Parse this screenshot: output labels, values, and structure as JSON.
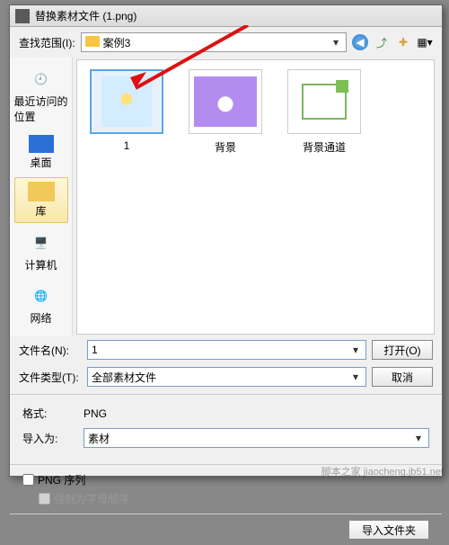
{
  "title": "替换素材文件 (1.png)",
  "lookin": {
    "label": "查找范围(I):",
    "folder": "案例3"
  },
  "places": [
    {
      "label": "最近访问的位置"
    },
    {
      "label": "桌面"
    },
    {
      "label": "库"
    },
    {
      "label": "计算机"
    },
    {
      "label": "网络"
    }
  ],
  "files": [
    {
      "label": "1"
    },
    {
      "label": "背景"
    },
    {
      "label": "背景通道"
    }
  ],
  "filename": {
    "label": "文件名(N):",
    "value": "1"
  },
  "filetype": {
    "label": "文件类型(T):",
    "value": "全部素材文件"
  },
  "buttons": {
    "open": "打开(O)",
    "cancel": "取消",
    "import_folder": "导入文件夹"
  },
  "format": {
    "label": "格式:",
    "value": "PNG"
  },
  "importas": {
    "label": "导入为:",
    "value": "素材"
  },
  "sequence": {
    "png_seq": "PNG 序列",
    "force_alpha": "强制为字母顺序"
  },
  "toolicons": {
    "back": "back-icon",
    "up": "up-icon",
    "new": "new-folder-icon",
    "view": "view-menu-icon"
  },
  "watermark": "脚本之家 jiaocheng.jb51.net"
}
